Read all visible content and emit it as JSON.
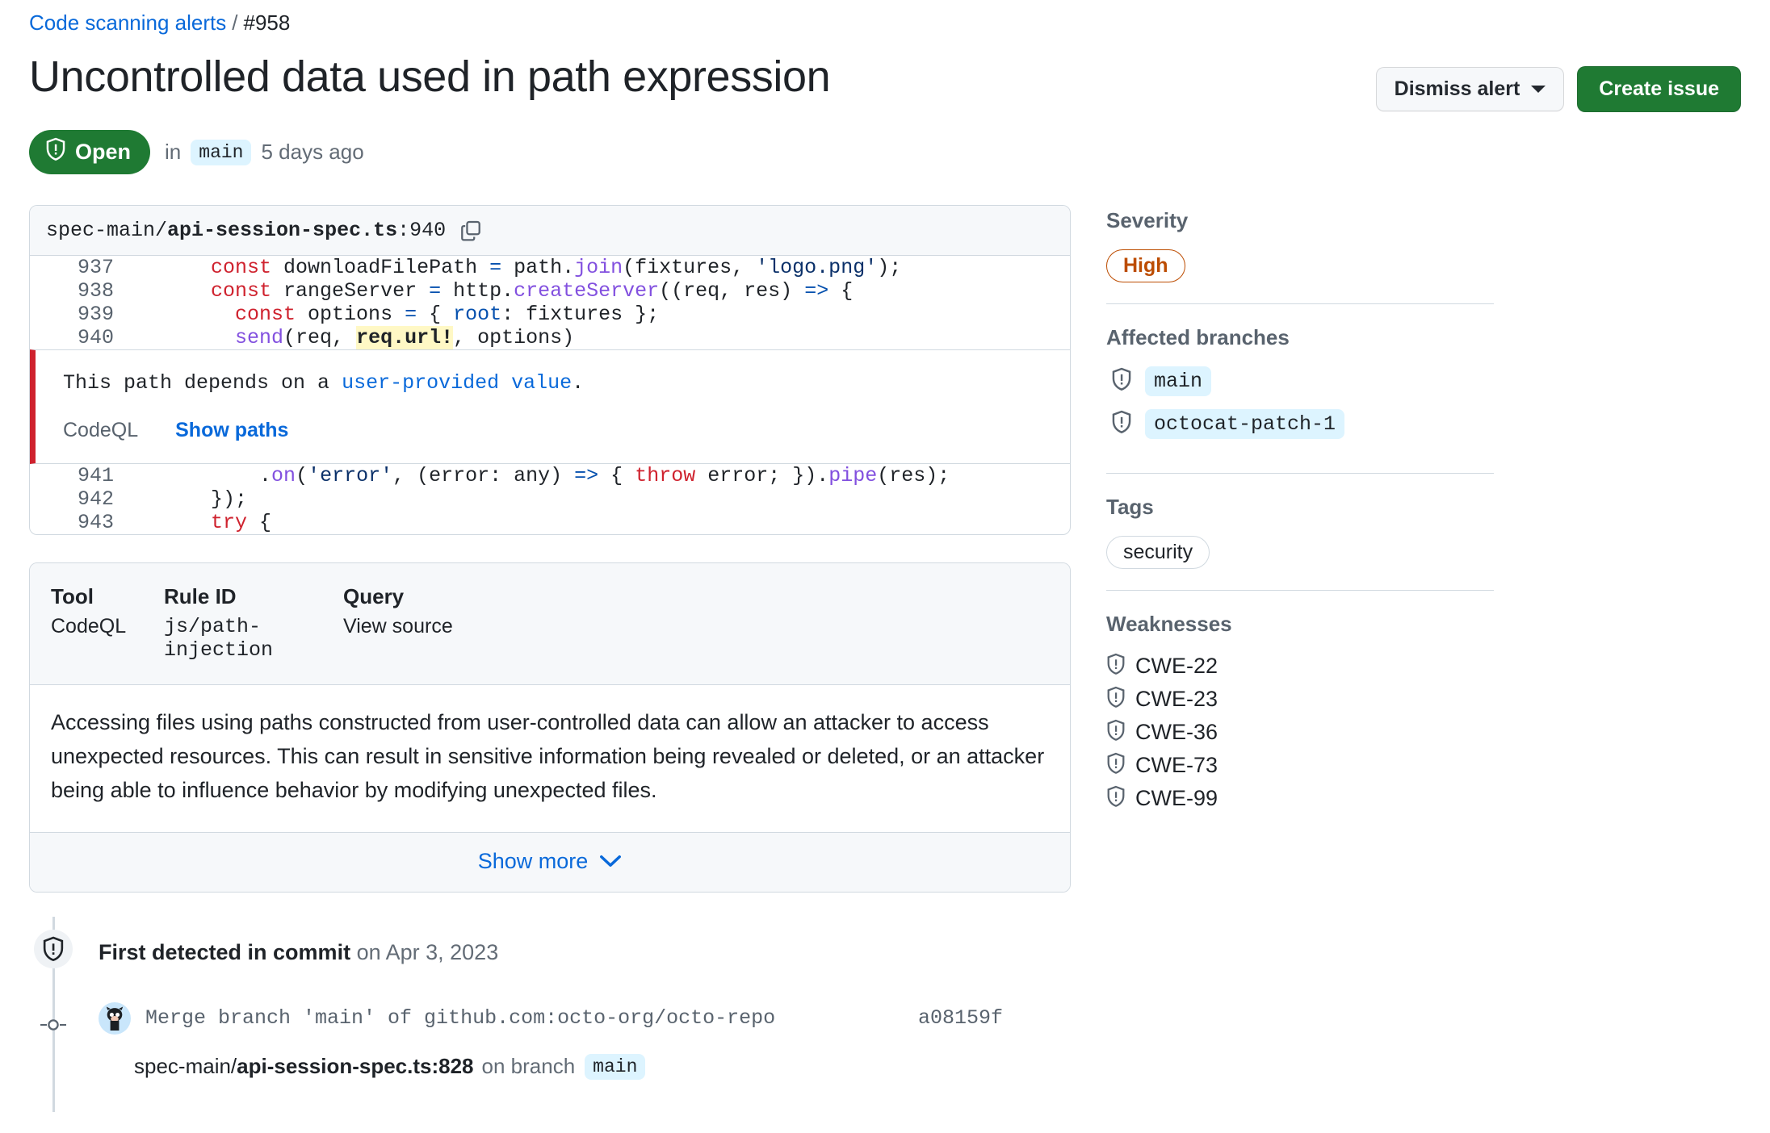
{
  "breadcrumb": {
    "parent_label": "Code scanning alerts",
    "separator": "/",
    "alert_number": "#958"
  },
  "header": {
    "title": "Uncontrolled data used in path expression",
    "dismiss_button": "Dismiss alert",
    "create_issue_button": "Create issue",
    "state": "Open",
    "in_word": "in",
    "branch": "main",
    "time_ago": "5 days ago"
  },
  "code": {
    "path_prefix": "spec-main/",
    "file_name": "api-session-spec.ts",
    "line_suffix": ":940",
    "copy_icon": "copy-icon",
    "lines_before": [
      {
        "number": "937",
        "tokens": [
          {
            "t": "        ",
            "c": ""
          },
          {
            "t": "const",
            "c": "tk-kw"
          },
          {
            "t": " downloadFilePath ",
            "c": ""
          },
          {
            "t": "=",
            "c": "tk-op"
          },
          {
            "t": " path.",
            "c": ""
          },
          {
            "t": "join",
            "c": "tk-fn"
          },
          {
            "t": "(fixtures, ",
            "c": ""
          },
          {
            "t": "'logo.png'",
            "c": "tk-str"
          },
          {
            "t": ");",
            "c": ""
          }
        ]
      },
      {
        "number": "938",
        "tokens": [
          {
            "t": "        ",
            "c": ""
          },
          {
            "t": "const",
            "c": "tk-kw"
          },
          {
            "t": " rangeServer ",
            "c": ""
          },
          {
            "t": "=",
            "c": "tk-op"
          },
          {
            "t": " http.",
            "c": ""
          },
          {
            "t": "createServer",
            "c": "tk-fn"
          },
          {
            "t": "((req, res) ",
            "c": ""
          },
          {
            "t": "=>",
            "c": "tk-op"
          },
          {
            "t": " {",
            "c": ""
          }
        ]
      },
      {
        "number": "939",
        "tokens": [
          {
            "t": "          ",
            "c": ""
          },
          {
            "t": "const",
            "c": "tk-kw"
          },
          {
            "t": " options ",
            "c": ""
          },
          {
            "t": "=",
            "c": "tk-op"
          },
          {
            "t": " { ",
            "c": ""
          },
          {
            "t": "root",
            "c": "tk-pr"
          },
          {
            "t": ": fixtures };",
            "c": ""
          }
        ]
      },
      {
        "number": "940",
        "tokens": [
          {
            "t": "          ",
            "c": ""
          },
          {
            "t": "send",
            "c": "tk-fn"
          },
          {
            "t": "(req, ",
            "c": ""
          },
          {
            "t": "req.url!",
            "c": "hl"
          },
          {
            "t": ", options)",
            "c": ""
          }
        ]
      }
    ],
    "lines_after": [
      {
        "number": "941",
        "tokens": [
          {
            "t": "            ",
            "c": ""
          },
          {
            "t": ".",
            "c": ""
          },
          {
            "t": "on",
            "c": "tk-fn"
          },
          {
            "t": "(",
            "c": ""
          },
          {
            "t": "'error'",
            "c": "tk-str"
          },
          {
            "t": ", (error: any) ",
            "c": ""
          },
          {
            "t": "=>",
            "c": "tk-op"
          },
          {
            "t": " { ",
            "c": ""
          },
          {
            "t": "throw",
            "c": "tk-kw"
          },
          {
            "t": " error; }).",
            "c": ""
          },
          {
            "t": "pipe",
            "c": "tk-fn"
          },
          {
            "t": "(res);",
            "c": ""
          }
        ]
      },
      {
        "number": "942",
        "tokens": [
          {
            "t": "        });",
            "c": ""
          }
        ]
      },
      {
        "number": "943",
        "tokens": [
          {
            "t": "        ",
            "c": ""
          },
          {
            "t": "try",
            "c": "tk-kw"
          },
          {
            "t": " {",
            "c": ""
          }
        ]
      }
    ],
    "alert_message_prefix": "This path depends on a ",
    "alert_message_link": "user-provided value",
    "alert_message_suffix": ".",
    "tool_name": "CodeQL",
    "show_paths_link": "Show paths"
  },
  "rule": {
    "tool_label": "Tool",
    "tool_value": "CodeQL",
    "rule_id_label": "Rule ID",
    "rule_id_value": "js/path-injection",
    "query_label": "Query",
    "query_value": "View source",
    "description": "Accessing files using paths constructed from user-controlled data can allow an attacker to access unexpected resources. This can result in sensitive information being revealed or deleted, or an attacker being able to influence behavior by modifying unexpected files.",
    "show_more_label": "Show more",
    "show_more_icon": "chevron-down-icon"
  },
  "timeline": {
    "detected_bold": "First detected in commit",
    "detected_rest": " on Apr 3, 2023",
    "detected_icon": "shield-alert-icon",
    "commit_message": "Merge branch 'main' of github.com:octo-org/octo-repo",
    "commit_sha": "a08159f",
    "avatar_icon": "octocat-avatar",
    "sub_path_prefix": "spec-main/",
    "sub_path_file": "api-session-spec.ts:828",
    "sub_on_branch": "on branch",
    "sub_branch": "main"
  },
  "sidebar": {
    "severity_title": "Severity",
    "severity_value": "High",
    "severity_color": "#bc4c00",
    "branches_title": "Affected branches",
    "branches": [
      {
        "name": "main",
        "icon": "shield-alert-icon"
      },
      {
        "name": "octocat-patch-1",
        "icon": "shield-alert-icon"
      }
    ],
    "tags_title": "Tags",
    "tags": [
      "security"
    ],
    "weaknesses_title": "Weaknesses",
    "weaknesses": [
      {
        "id": "CWE-22",
        "icon": "shield-alert-icon"
      },
      {
        "id": "CWE-23",
        "icon": "shield-alert-icon"
      },
      {
        "id": "CWE-36",
        "icon": "shield-alert-icon"
      },
      {
        "id": "CWE-73",
        "icon": "shield-alert-icon"
      },
      {
        "id": "CWE-99",
        "icon": "shield-alert-icon"
      }
    ]
  }
}
